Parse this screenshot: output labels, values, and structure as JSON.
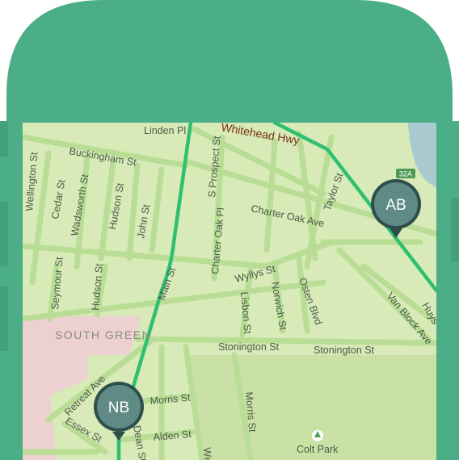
{
  "colors": {
    "phone_frame": "#4cae86",
    "map_land": "#d7eab7",
    "road": "#b9dd95",
    "route": "#2fbf71",
    "water": "#a9cbcf",
    "pin": "#5f8a85"
  },
  "markers": {
    "start": "NB",
    "end": "AB"
  },
  "highway_shield": "32A",
  "labels": {
    "whitehead_hwy": "Whitehead Hwy",
    "linden_pl": "Linden Pl",
    "buckingham_st": "Buckingham St",
    "s_prospect_st": "S Prospect St",
    "cedar_st": "Cedar St",
    "wadsworth_st": "Wadsworth St",
    "hudson_st_top": "Hudson St",
    "john_st": "John St",
    "charter_oak_ave": "Charter Oak Ave",
    "charter_oak_pl": "Charter Oak Pl",
    "taylor_st": "Taylor St",
    "wellington_st": "Wellington St",
    "seymour_st": "Seymour St",
    "hudson_st_bottom": "Hudson St",
    "main_st": "Main St",
    "wyllys_st": "Wyllys St",
    "lisbon_st": "Lisbon St",
    "norwich_st": "Norwich St",
    "osten_blvd": "Osten Blvd",
    "van_block_ave": "Van Block Ave",
    "huyshope_ave": "Huys",
    "south_green": "SOUTH GREEN",
    "stonington_st_1": "Stonington St",
    "stonington_st_2": "Stonington St",
    "retreat_ave": "Retreat Ave",
    "essex_st": "Essex St",
    "morris_st_h": "Morris St",
    "morris_st_v": "Morris St",
    "alden_st": "Alden St",
    "dean_st": "Dean St",
    "we_st": "We",
    "colt_park": "Colt Park"
  }
}
